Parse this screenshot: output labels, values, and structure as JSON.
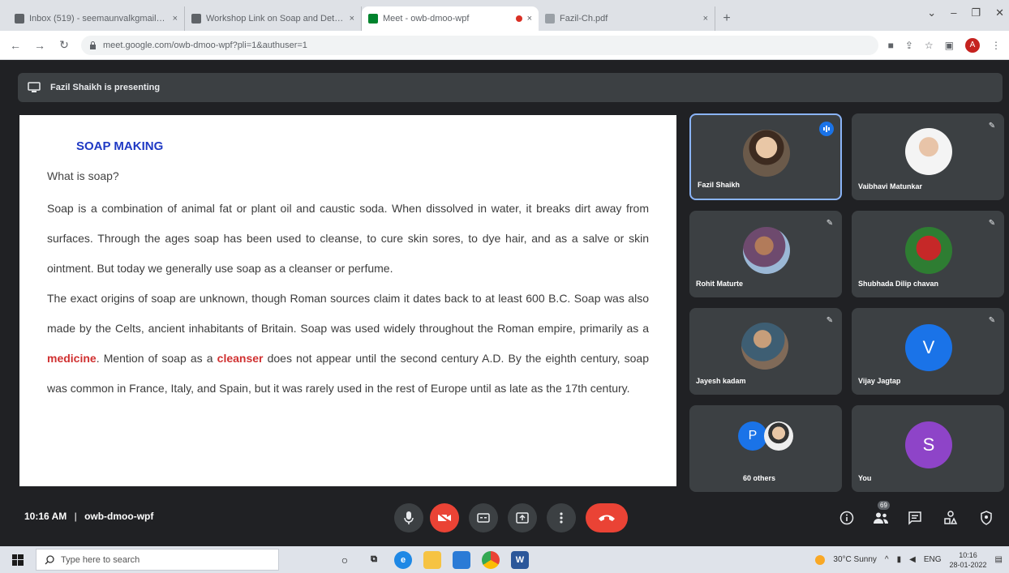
{
  "browser": {
    "tabs": [
      {
        "title": "Inbox (519) - seemaunvalkgmail.com",
        "close": "×",
        "favicon_color": "#5f6368"
      },
      {
        "title": "Workshop Link on Soap and Detergent",
        "close": "×",
        "favicon_color": "#5f6368"
      },
      {
        "title": "Meet - owb-dmoo-wpf",
        "close": "×",
        "favicon_color": "#00832d",
        "active": true
      },
      {
        "title": "",
        "close": "×",
        "recording": true
      },
      {
        "title": "Fazil-Ch.pdf",
        "close": "×",
        "favicon_color": "#9aa0a6"
      }
    ],
    "new_tab": "+",
    "window_controls": [
      "⌄",
      "–",
      "❐",
      "✕"
    ],
    "nav": {
      "back": "←",
      "forward": "→",
      "reload": "↻"
    },
    "url": "meet.google.com/owb-dmoo-wpf?pli=1&authuser=1",
    "profile_initial": "A"
  },
  "meet": {
    "presenting_text": "Fazil Shaikh is presenting",
    "slide": {
      "title": "SOAP MAKING",
      "question": "What is soap?",
      "p1": "Soap is a combination of animal fat or plant oil and caustic soda. When dissolved in water, it breaks dirt away from surfaces. Through the ages soap has been used to cleanse, to cure skin sores, to dye hair, and as a salve or skin ointment. But today we generally use soap as a cleanser or perfume.",
      "p2_a": "The exact origins of soap are unknown, though Roman sources claim it dates back to at least 600 B.C. Soap was also made by the Celts, ancient inhabitants of Britain. Soap was used widely throughout the Roman empire, primarily as a ",
      "p2_red1": "medicine",
      "p2_b": ". Mention of soap as a ",
      "p2_red2": "cleanser",
      "p2_c": " does not appear until the second century A.D. By the eighth century, soap was common in France, Italy, and Spain, but it was rarely used in the rest of Europe until as late as the 17th century."
    },
    "participants": [
      {
        "name": "Fazil Shaikh",
        "type": "photo",
        "speaking": true
      },
      {
        "name": "Vaibhavi Matunkar",
        "type": "photo",
        "muted": true
      },
      {
        "name": "Rohit Maturte",
        "type": "photo",
        "muted": true
      },
      {
        "name": "Shubhada Dilip chavan",
        "type": "photo",
        "muted": true
      },
      {
        "name": "Jayesh kadam",
        "type": "photo",
        "muted": true
      },
      {
        "name": "Vijay Jagtap",
        "type": "letter",
        "letter": "V",
        "color": "#1a73e8",
        "muted": true
      },
      {
        "name": "60 others",
        "type": "group",
        "letter": "P",
        "color": "#1a73e8"
      },
      {
        "name": "You",
        "type": "letter",
        "letter": "S",
        "color": "#8e44c8"
      }
    ],
    "time": "10:16 AM",
    "separator": "|",
    "meeting_code": "owb-dmoo-wpf",
    "people_count": "69"
  },
  "taskbar": {
    "search_placeholder": "Type here to search",
    "weather": "30°C Sunny",
    "lang": "ENG",
    "time": "10:16",
    "date": "28-01-2022"
  }
}
